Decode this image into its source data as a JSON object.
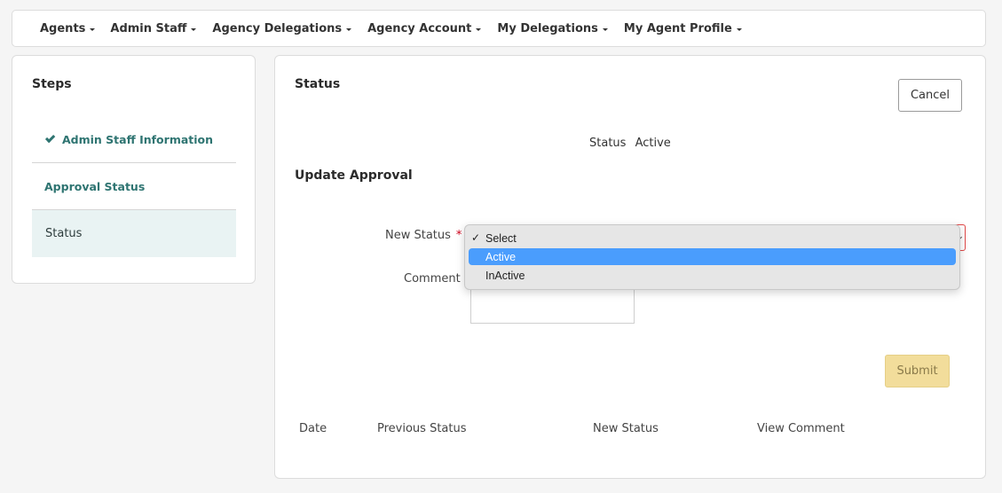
{
  "nav": {
    "items": [
      "Agents",
      "Admin Staff",
      "Agency Delegations",
      "Agency Account",
      "My Delegations",
      "My Agent Profile"
    ]
  },
  "steps": {
    "title": "Steps",
    "items": [
      {
        "label": "Admin Staff Information",
        "state": "completed"
      },
      {
        "label": "Approval Status",
        "state": "link"
      },
      {
        "label": "Status",
        "state": "active"
      }
    ]
  },
  "main": {
    "title": "Status",
    "cancel_label": "Cancel",
    "current_status_label": "Status",
    "current_status_value": "Active",
    "update_title": "Update Approval",
    "new_status_label": "New Status",
    "required_marker": "*",
    "comment_label": "Comment",
    "submit_label": "Submit",
    "table_headers": [
      "Date",
      "Previous Status",
      "New Status",
      "View Comment"
    ]
  },
  "dropdown": {
    "options": [
      "Select",
      "Active",
      "InActive"
    ],
    "checked": "Select",
    "highlighted": "Active"
  },
  "colors": {
    "accent": "#2e7471",
    "highlight": "#4a9dfd",
    "submit_bg": "#f2dd9b",
    "error_border": "#e04848"
  }
}
